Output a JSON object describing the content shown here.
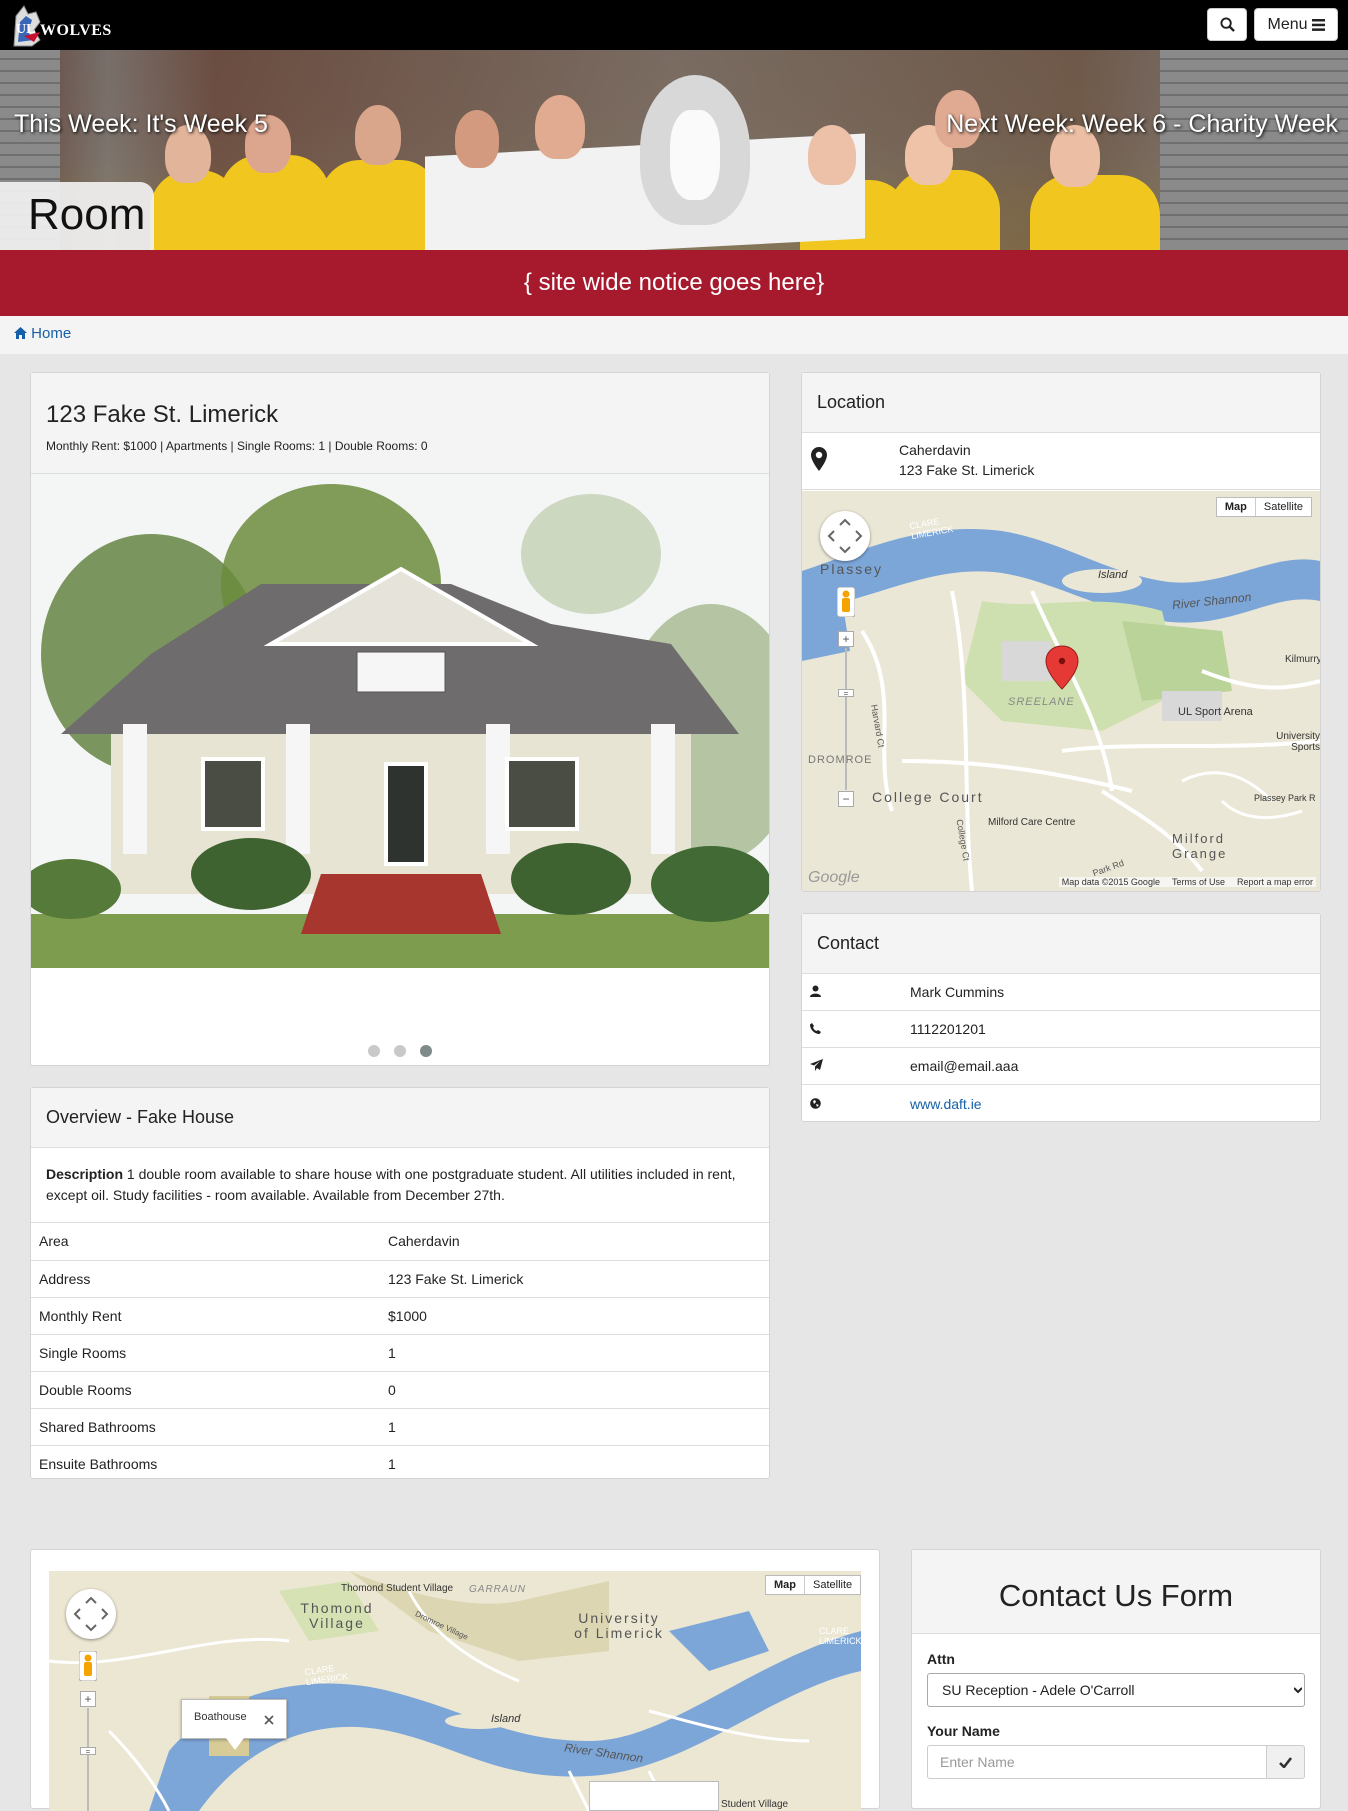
{
  "header": {
    "logo_ul": "UL",
    "logo_text": "WOLVES",
    "menu_label": "Menu"
  },
  "hero": {
    "this_week": "This Week: It's Week 5",
    "next_week": "Next Week: Week 6 - Charity Week",
    "page_title": "Room"
  },
  "notice": "{ site wide notice goes here}",
  "breadcrumb": {
    "home": "Home"
  },
  "listing": {
    "title": "123 Fake St. Limerick",
    "subtitle": "Monthly Rent: $1000 | Apartments | Single Rooms: 1 | Double Rooms: 0",
    "slide_count": 3,
    "active_slide": 3
  },
  "overview": {
    "heading": "Overview - Fake House",
    "desc_label": "Description",
    "desc_text": " 1 double room available to share house with one postgraduate student. All utilities included in rent, except oil. Study facilities - room available. Available from December 27th.",
    "rows": [
      {
        "k": "Area",
        "v": "Caherdavin"
      },
      {
        "k": "Address",
        "v": "123 Fake St. Limerick"
      },
      {
        "k": "Monthly Rent",
        "v": "$1000"
      },
      {
        "k": "Single Rooms",
        "v": "1"
      },
      {
        "k": "Double Rooms",
        "v": "0"
      },
      {
        "k": "Shared Bathrooms",
        "v": "1"
      },
      {
        "k": "Ensuite Bathrooms",
        "v": "1"
      }
    ]
  },
  "location": {
    "heading": "Location",
    "area": "Caherdavin",
    "address": "123 Fake St. Limerick",
    "map": {
      "btn_map": "Map",
      "btn_satellite": "Satellite",
      "labels": [
        "Plassey",
        "Island",
        "River Shannon",
        "SREELANE",
        "UL Sport Arena",
        "University Sports",
        "DROMROE",
        "College Court",
        "Milford Care Centre",
        "Milford Grange",
        "Plassey Park R",
        "Kilmurry",
        "CLARE LIMERICK",
        "Harvard Ct",
        "College Ct",
        "Park Rd"
      ],
      "google": "Google",
      "attribution": "Map data ©2015 Google",
      "terms": "Terms of Use",
      "report": "Report a map error"
    }
  },
  "contact": {
    "heading": "Contact",
    "name": "Mark Cummins",
    "phone": "1112201201",
    "email": "email@email.aaa",
    "web": "www.daft.ie"
  },
  "bottom_map": {
    "btn_map": "Map",
    "btn_satellite": "Satellite",
    "labels": [
      "Thomond Student Village",
      "GARRAUN",
      "Thomond Village",
      "Dromroe Village",
      "University of Limerick",
      "CLARE LIMERICK",
      "Island",
      "River Shannon",
      "CLARE LIMERICK",
      "Student Village"
    ],
    "popup": "Boathouse"
  },
  "contact_form": {
    "title": "Contact Us Form",
    "attn_label": "Attn",
    "attn_value": "SU Reception - Adele O'Carroll",
    "name_label": "Your Name",
    "name_placeholder": "Enter Name"
  }
}
